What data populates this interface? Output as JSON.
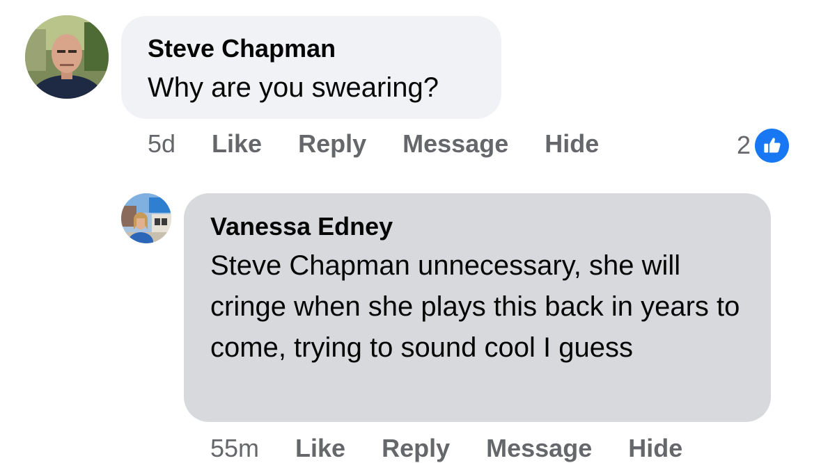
{
  "comments": [
    {
      "author": "Steve Chapman",
      "text": "Why are you swearing?",
      "time": "5d",
      "actions": {
        "like": "Like",
        "reply": "Reply",
        "message": "Message",
        "hide": "Hide"
      },
      "reaction_count": "2",
      "reaction_icon": "thumbs-up-icon",
      "reaction_color": "#1877f2",
      "avatar_icon": "profile-photo"
    },
    {
      "author": "Vanessa Edney",
      "text": "Steve Chapman unnecessary, she will cringe when she plays this back in years to come, trying to sound cool I guess",
      "time": "55m",
      "actions": {
        "like": "Like",
        "reply": "Reply",
        "message": "Message",
        "hide": "Hide"
      },
      "avatar_icon": "profile-photo"
    }
  ],
  "colors": {
    "bubble_top": "#f0f2f5",
    "bubble_reply": "#d7d9dd",
    "meta_text": "#65676b",
    "accent": "#1877f2"
  }
}
